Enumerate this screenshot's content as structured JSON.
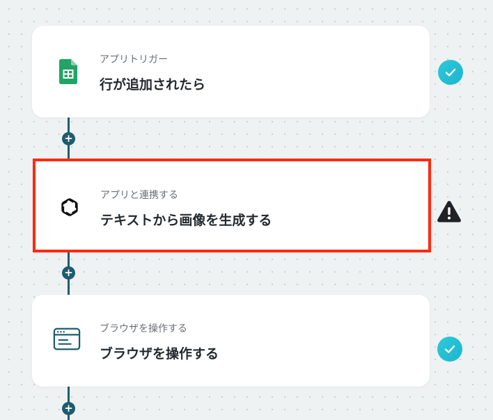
{
  "steps": [
    {
      "subtitle": "アプリトリガー",
      "title": "行が追加されたら",
      "icon": "google-sheets-icon",
      "status": "check-circle-icon"
    },
    {
      "subtitle": "アプリと連携する",
      "title": "テキストから画像を生成する",
      "icon": "openai-icon",
      "status": "warning-icon"
    },
    {
      "subtitle": "ブラウザを操作する",
      "title": "ブラウザを操作する",
      "icon": "browser-window-icon",
      "status": "check-circle-icon"
    }
  ],
  "add_step_label": "+",
  "colors": {
    "background": "#eef2f2",
    "connector": "#1d5c6e",
    "selected_border": "#ff2a12",
    "check": "#21bed4",
    "warning": "#1f2226",
    "sheets_green": "#21a464"
  }
}
